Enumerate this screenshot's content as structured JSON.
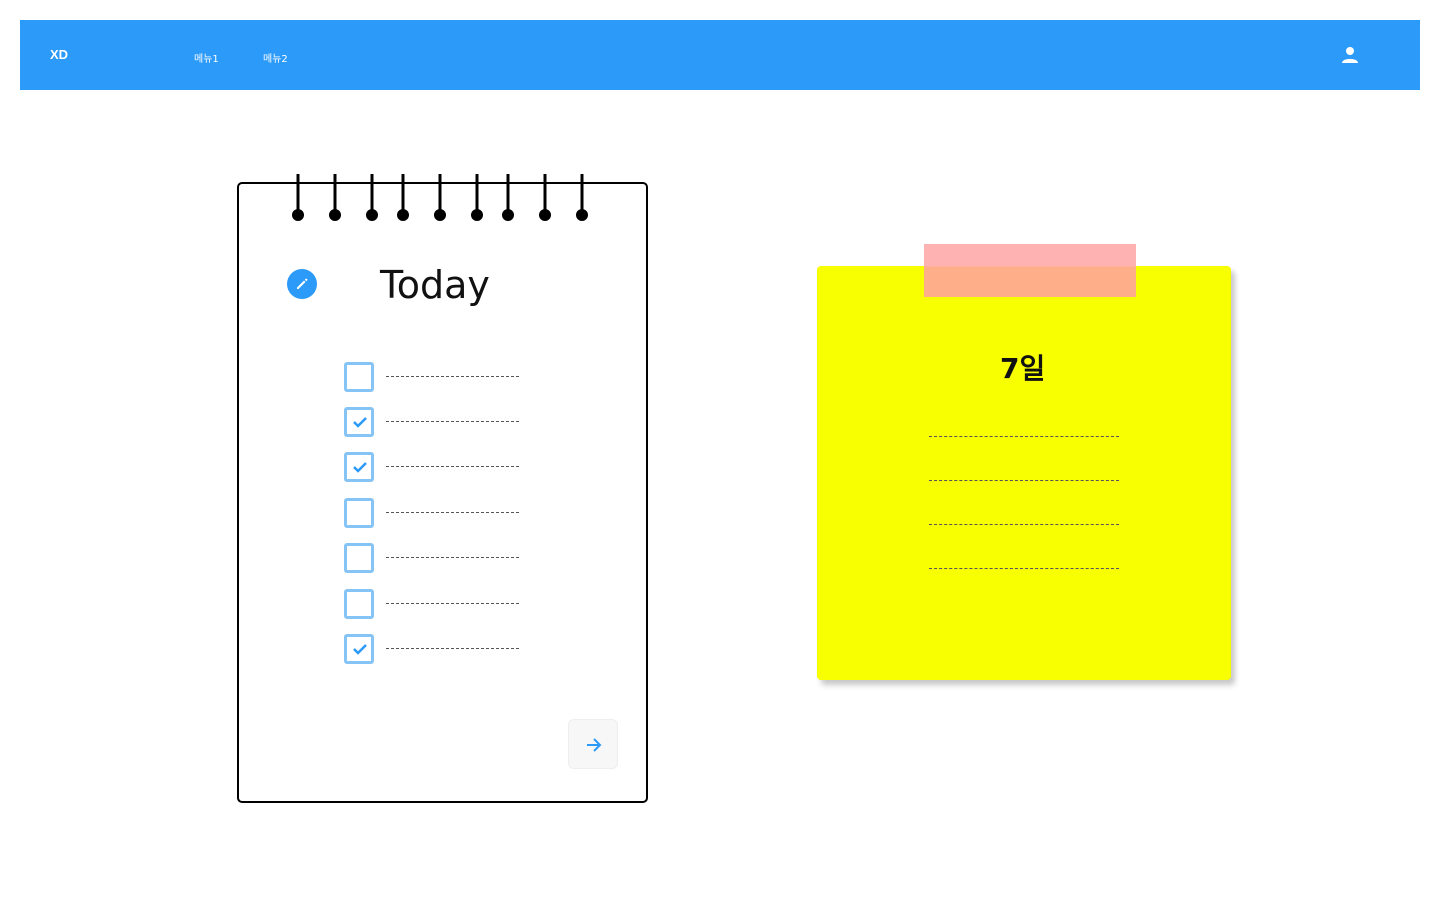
{
  "nav": {
    "logo": "XD",
    "menu1": "메뉴1",
    "menu2": "메뉴2",
    "user_icon": "user-icon",
    "color": "#2b9af9"
  },
  "notebook": {
    "title": "Today",
    "edit_icon": "pencil-icon",
    "next_icon": "arrow-right-icon",
    "tasks": [
      {
        "checked": false
      },
      {
        "checked": true
      },
      {
        "checked": true
      },
      {
        "checked": false
      },
      {
        "checked": false
      },
      {
        "checked": false
      },
      {
        "checked": true
      }
    ]
  },
  "sticky_note": {
    "title": "7일",
    "line_count": 4,
    "color": "#f7ff00",
    "tape_colors": [
      "#ffb2b2",
      "#ffae8a"
    ]
  }
}
